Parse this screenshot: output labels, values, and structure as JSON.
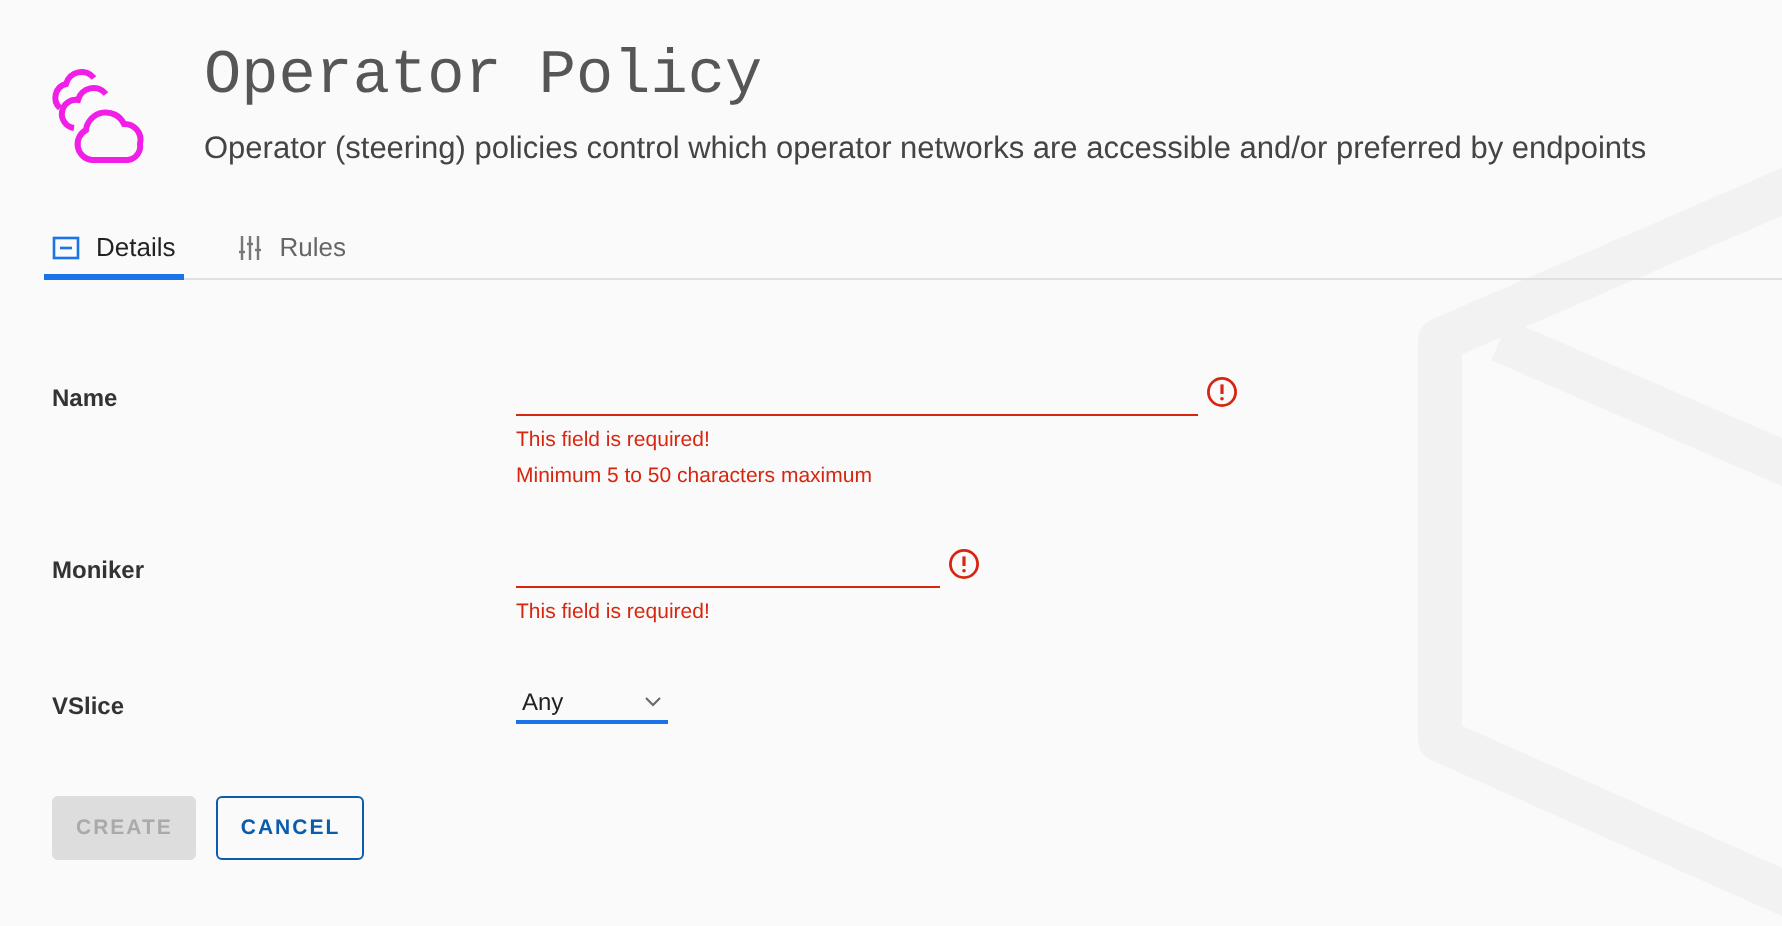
{
  "header": {
    "title": "Operator Policy",
    "description": "Operator (steering) policies control which operator networks are accessible and/or preferred by endpoints"
  },
  "tabs": [
    {
      "label": "Details",
      "kind": "details",
      "selected": true
    },
    {
      "label": "Rules",
      "kind": "rules",
      "selected": false
    }
  ],
  "fields": [
    {
      "kind": "text",
      "label": "Name",
      "invalid": true,
      "errors": [
        "This field is required!",
        "Minimum 5 to 50 characters maximum"
      ]
    },
    {
      "kind": "text",
      "label": "Moniker",
      "invalid": true,
      "errors": [
        "This field is required!"
      ]
    },
    {
      "kind": "select",
      "label": "VSlice",
      "value": "Any"
    }
  ],
  "buttons": [
    {
      "label": "CREATE",
      "kind": "primary",
      "disabled": true
    },
    {
      "label": "CANCEL",
      "kind": "outline",
      "disabled": false
    }
  ]
}
